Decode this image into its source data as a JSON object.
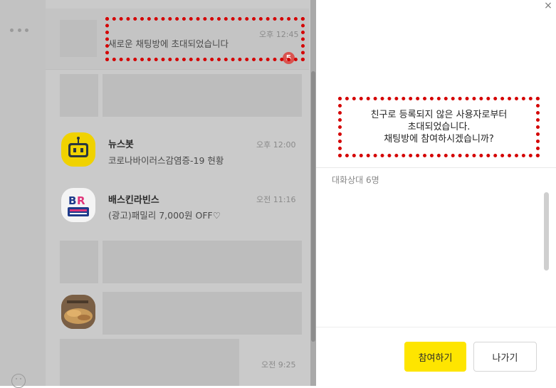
{
  "chat_list": {
    "rows": [
      {
        "time": "오후 12:45",
        "preview": "새로운 채팅방에 초대되었습니다",
        "unread": "5"
      },
      {
        "name": "",
        "preview": "",
        "time": ""
      },
      {
        "name": "뉴스봇",
        "preview": "코로나바이러스감염증-19 현황",
        "time": "오후 12:00"
      },
      {
        "name": "배스킨라빈스",
        "preview": "(광고)패밀리 7,000원 OFF♡",
        "time": "오전 11:16"
      },
      {
        "name": "",
        "preview": "",
        "time": ""
      },
      {
        "name": "",
        "preview": "",
        "time": ""
      },
      {
        "name": "",
        "preview": "",
        "time": "오전 9:25"
      }
    ]
  },
  "dialog": {
    "invite_lines": [
      "친구로 등록되지 않은 사용자로부터",
      "초대되었습니다.",
      "채팅방에 참여하시겠습니까?"
    ],
    "member_count": "대화상대 6명",
    "join_label": "참여하기",
    "leave_label": "나가기",
    "close_label": "×"
  },
  "colors": {
    "accent_yellow": "#fee500",
    "annotation_red": "#d40000",
    "unread_badge": "#d9534f"
  }
}
